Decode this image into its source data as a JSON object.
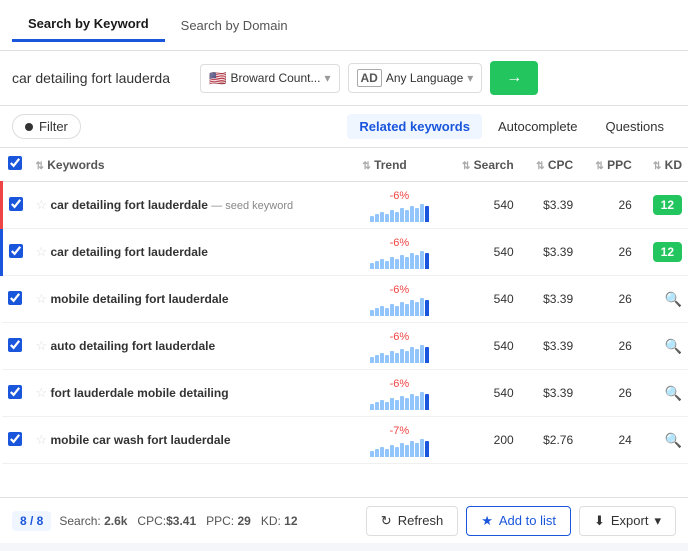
{
  "tabs": [
    {
      "label": "Search by Keyword",
      "active": true
    },
    {
      "label": "Search by Domain",
      "active": false
    }
  ],
  "search": {
    "query": "car detailing fort lauderda",
    "location": "Broward Count...",
    "language": "Any Language",
    "go_label": "→"
  },
  "filter": {
    "label": "Filter"
  },
  "keyword_tabs": [
    {
      "label": "Related keywords",
      "active": true
    },
    {
      "label": "Autocomplete",
      "active": false
    },
    {
      "label": "Questions",
      "active": false
    }
  ],
  "table": {
    "headers": [
      {
        "label": "Keywords",
        "sort": true
      },
      {
        "label": "Trend",
        "sort": true
      },
      {
        "label": "Search",
        "sort": true
      },
      {
        "label": "CPC",
        "sort": true
      },
      {
        "label": "PPC",
        "sort": true
      },
      {
        "label": "KD",
        "sort": true
      }
    ],
    "rows": [
      {
        "checked": true,
        "starred": false,
        "keyword": "car detailing fort lauderdale",
        "seed": true,
        "seed_label": "— seed keyword",
        "trend_percent": "-6%",
        "trend_bars": [
          3,
          4,
          5,
          4,
          6,
          5,
          7,
          6,
          8,
          7,
          9,
          8
        ],
        "search": "540",
        "cpc": "$3.39",
        "ppc": "26",
        "kd": "12",
        "kd_type": "badge",
        "row_type": "seed"
      },
      {
        "checked": true,
        "starred": false,
        "keyword": "car detailing fort lauderdale",
        "seed": false,
        "seed_label": "",
        "trend_percent": "-6%",
        "trend_bars": [
          3,
          4,
          5,
          4,
          6,
          5,
          7,
          6,
          8,
          7,
          9,
          8
        ],
        "search": "540",
        "cpc": "$3.39",
        "ppc": "26",
        "kd": "12",
        "kd_type": "badge",
        "row_type": "highlighted"
      },
      {
        "checked": true,
        "starred": false,
        "keyword": "mobile detailing fort lauderdale",
        "seed": false,
        "seed_label": "",
        "trend_percent": "-6%",
        "trend_bars": [
          3,
          4,
          5,
          4,
          6,
          5,
          7,
          6,
          8,
          7,
          9,
          8
        ],
        "search": "540",
        "cpc": "$3.39",
        "ppc": "26",
        "kd": "",
        "kd_type": "search",
        "row_type": "normal"
      },
      {
        "checked": true,
        "starred": false,
        "keyword": "auto detailing fort lauderdale",
        "seed": false,
        "seed_label": "",
        "trend_percent": "-6%",
        "trend_bars": [
          3,
          4,
          5,
          4,
          6,
          5,
          7,
          6,
          8,
          7,
          9,
          8
        ],
        "search": "540",
        "cpc": "$3.39",
        "ppc": "26",
        "kd": "",
        "kd_type": "search",
        "row_type": "normal"
      },
      {
        "checked": true,
        "starred": false,
        "keyword": "fort lauderdale mobile detailing",
        "seed": false,
        "seed_label": "",
        "trend_percent": "-6%",
        "trend_bars": [
          3,
          4,
          5,
          4,
          6,
          5,
          7,
          6,
          8,
          7,
          9,
          8
        ],
        "search": "540",
        "cpc": "$3.39",
        "ppc": "26",
        "kd": "",
        "kd_type": "search",
        "row_type": "normal"
      },
      {
        "checked": true,
        "starred": false,
        "keyword": "mobile car wash fort lauderdale",
        "seed": false,
        "seed_label": "",
        "trend_percent": "-7%",
        "trend_bars": [
          3,
          4,
          5,
          4,
          6,
          5,
          7,
          6,
          8,
          7,
          9,
          8
        ],
        "search": "200",
        "cpc": "$2.76",
        "ppc": "24",
        "kd": "",
        "kd_type": "search",
        "row_type": "normal"
      }
    ]
  },
  "bottom": {
    "count": "8 / 8",
    "stats": "Search: 2.6k  CPC:$3.41  PPC: 29  KD: 12",
    "refresh_label": "Refresh",
    "addlist_label": "Add to list",
    "export_label": "Export"
  }
}
